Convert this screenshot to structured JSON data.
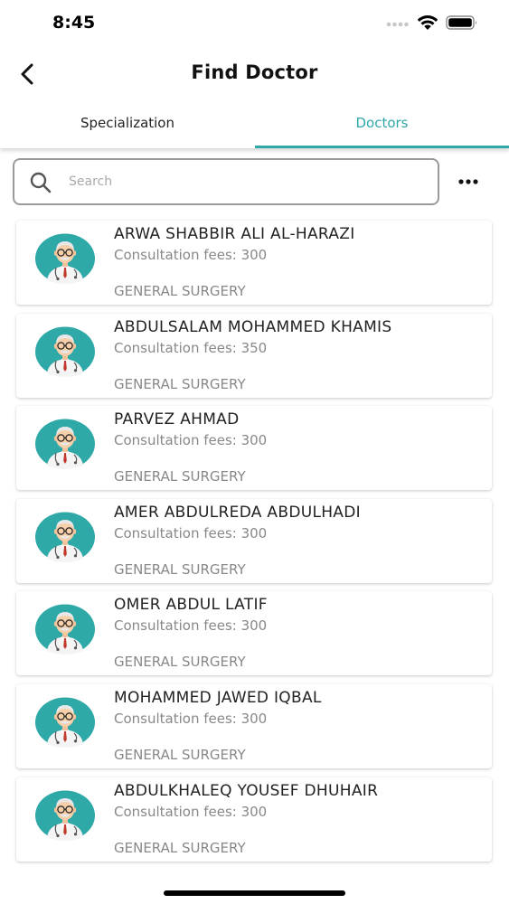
{
  "status": {
    "time": "8:45"
  },
  "nav": {
    "title": "Find Doctor"
  },
  "tabs": [
    {
      "label": "Specialization",
      "active": false
    },
    {
      "label": "Doctors",
      "active": true
    }
  ],
  "search": {
    "placeholder": "Search",
    "value": ""
  },
  "colors": {
    "accent": "#2fa8a8",
    "avatar_bg": "#2fa8a8"
  },
  "icons": {
    "back": "chevron-left-icon",
    "search": "magnifier-icon",
    "more": "ellipsis-icon",
    "avatar": "doctor-avatar-icon"
  },
  "doctors": [
    {
      "name": "ARWA SHABBIR ALI AL-HARAZI",
      "fee": "Consultation fees: 300",
      "specialization": "GENERAL SURGERY"
    },
    {
      "name": "ABDULSALAM MOHAMMED KHAMIS",
      "fee": "Consultation fees: 350",
      "specialization": "GENERAL SURGERY"
    },
    {
      "name": "PARVEZ AHMAD",
      "fee": "Consultation fees: 300",
      "specialization": "GENERAL SURGERY"
    },
    {
      "name": "AMER ABDULREDA ABDULHADI",
      "fee": "Consultation fees: 300",
      "specialization": "GENERAL SURGERY"
    },
    {
      "name": "OMER ABDUL LATIF",
      "fee": "Consultation fees: 300",
      "specialization": "GENERAL SURGERY"
    },
    {
      "name": "MOHAMMED JAWED IQBAL",
      "fee": "Consultation fees: 300",
      "specialization": "GENERAL SURGERY"
    },
    {
      "name": "ABDULKHALEQ YOUSEF DHUHAIR",
      "fee": "Consultation fees: 300",
      "specialization": "GENERAL SURGERY"
    }
  ]
}
